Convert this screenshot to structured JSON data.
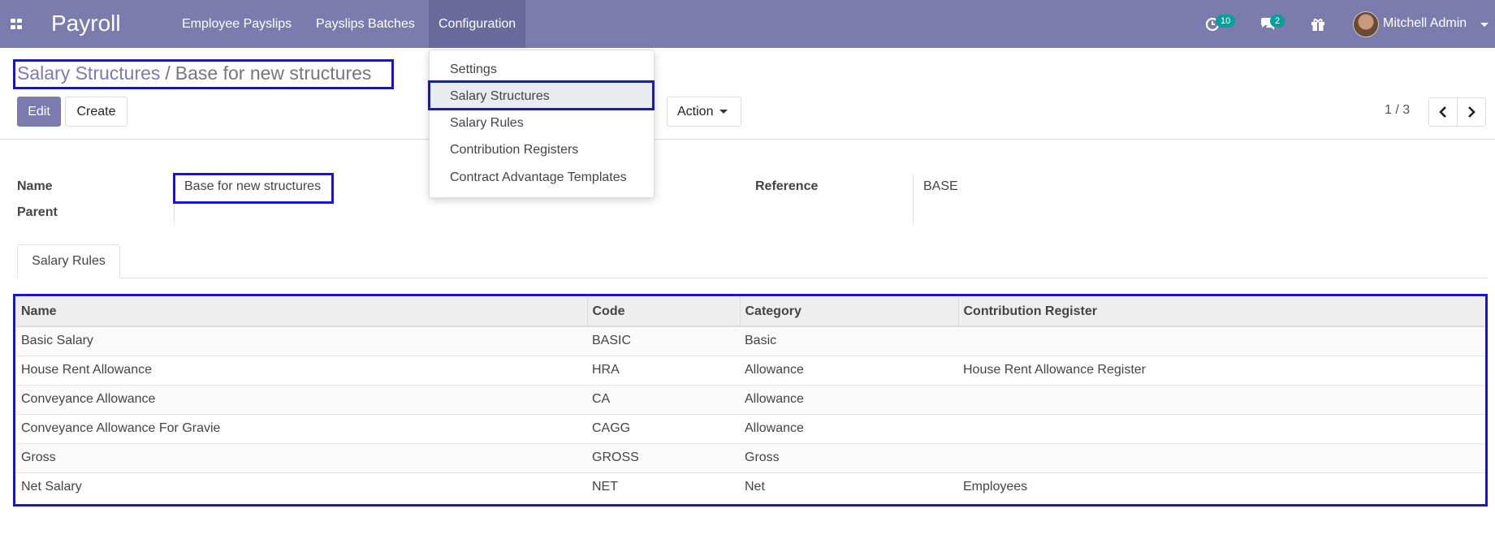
{
  "app": {
    "title": "Payroll"
  },
  "nav": {
    "items": [
      {
        "label": "Employee Payslips"
      },
      {
        "label": "Payslips Batches"
      },
      {
        "label": "Configuration"
      }
    ]
  },
  "systray": {
    "activity_count": "10",
    "message_count": "2",
    "user_name": "Mitchell Admin"
  },
  "breadcrumb": {
    "parent": "Salary Structures",
    "separator": "/",
    "current": "Base for new structures"
  },
  "buttons": {
    "edit": "Edit",
    "create": "Create",
    "action": "Action"
  },
  "pager": {
    "value": "1 / 3"
  },
  "config_menu": {
    "items": [
      {
        "label": "Settings"
      },
      {
        "label": "Salary Structures",
        "active": true
      },
      {
        "label": "Salary Rules"
      },
      {
        "label": "Contribution Registers"
      },
      {
        "label": "Contract Advantage Templates"
      }
    ]
  },
  "form": {
    "name_label": "Name",
    "name_value": "Base for new structures",
    "parent_label": "Parent",
    "parent_value": "",
    "reference_label": "Reference",
    "reference_value": "BASE"
  },
  "tabs": [
    {
      "label": "Salary Rules"
    }
  ],
  "table": {
    "headers": [
      "Name",
      "Code",
      "Category",
      "Contribution Register"
    ],
    "rows": [
      [
        "Basic Salary",
        "BASIC",
        "Basic",
        ""
      ],
      [
        "House Rent Allowance",
        "HRA",
        "Allowance",
        "House Rent Allowance Register"
      ],
      [
        "Conveyance Allowance",
        "CA",
        "Allowance",
        ""
      ],
      [
        "Conveyance Allowance For Gravie",
        "CAGG",
        "Allowance",
        ""
      ],
      [
        "Gross",
        "GROSS",
        "Gross",
        ""
      ],
      [
        "Net Salary",
        "NET",
        "Net",
        "Employees"
      ]
    ]
  },
  "colors": {
    "brand": "#7c7bad",
    "highlight": "#1714d6",
    "badge": "#00a09d"
  }
}
